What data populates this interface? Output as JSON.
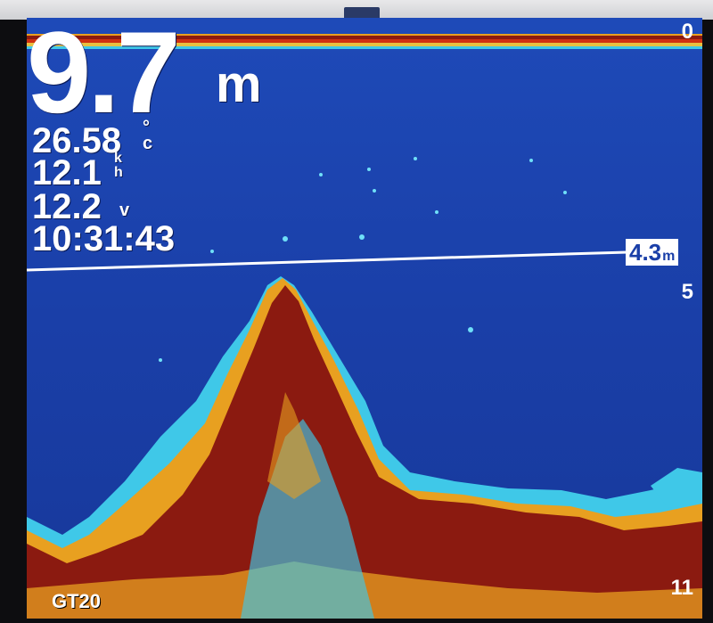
{
  "readouts": {
    "depth_value": "9.7",
    "depth_unit": "m",
    "water_temp_value": "26.58",
    "water_temp_unit_top": "°",
    "water_temp_unit_bottom": "c",
    "speed_value": "12.1",
    "speed_unit_top": "k",
    "speed_unit_bottom": "h",
    "voltage_value": "12.2",
    "voltage_unit": "v",
    "time": "10:31:43"
  },
  "depth_scale": {
    "top": "0",
    "middle": "5",
    "bottom": "11"
  },
  "depth_marker": {
    "value": "4.3",
    "unit": "m",
    "depth_m": 4.3
  },
  "device": {
    "model": "GT20"
  },
  "colors": {
    "water": "#1a3fa8",
    "strong_return": "#8b1a10",
    "medium_return": "#e8a020",
    "weak_return": "#3fc8e8",
    "text": "#ffffff"
  }
}
